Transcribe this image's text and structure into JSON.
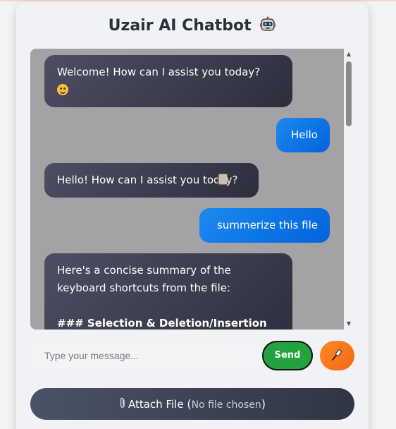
{
  "header": {
    "title": "Uzair AI Chatbot",
    "title_icon": "robot-icon"
  },
  "messages": [
    {
      "sender": "bot",
      "text_line1": "Welcome! How can I assist you today?",
      "emoji": "smiling-face"
    },
    {
      "sender": "user",
      "text": "Hello"
    },
    {
      "sender": "bot",
      "text_before": "Hello! How can I assist you tod",
      "text_after": "y?",
      "overlay_icon": "clipboard-icon"
    },
    {
      "sender": "user",
      "text": "summerize this file"
    },
    {
      "sender": "bot",
      "line1": "Here's a concise summary of the",
      "line2": "keyboard shortcuts from the file:",
      "line3": "### Selection & Deletion/Insertion"
    }
  ],
  "composer": {
    "placeholder": "Type your message...",
    "send_label": "Send",
    "mic_icon": "microphone-icon"
  },
  "attach": {
    "label": "Attach File",
    "status": "No file chosen",
    "icon": "paperclip-icon"
  },
  "colors": {
    "bot_bubble": "#3a3b4c",
    "user_bubble": "#0a74e8",
    "send_button": "#22a33f",
    "mic_button": "#f97a1c",
    "chat_background": "#a3a3a6"
  }
}
